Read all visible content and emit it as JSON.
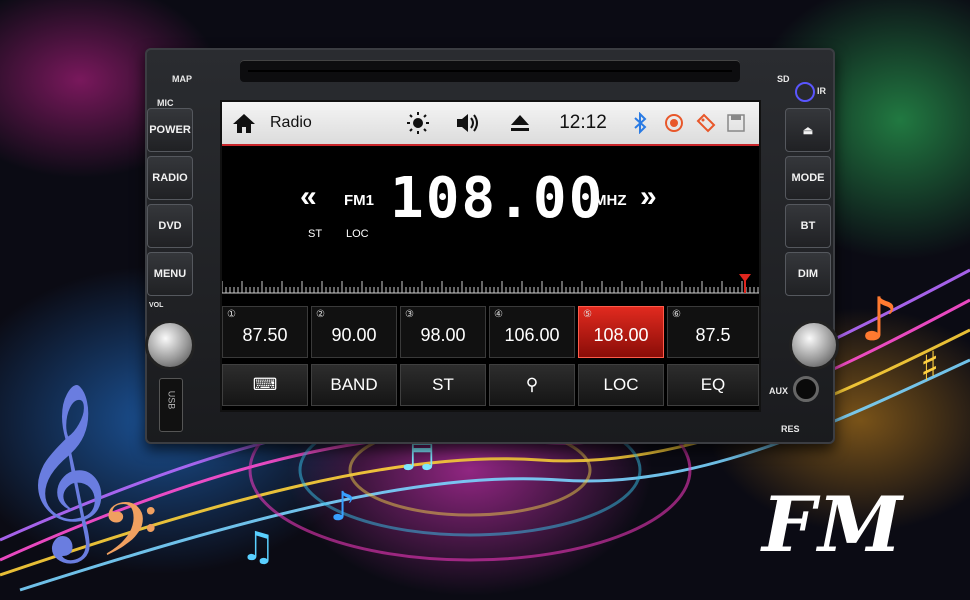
{
  "unit": {
    "labels": {
      "map": "MAP",
      "mic": "MIC",
      "sd": "SD",
      "ir": "IR",
      "vol": "VOL",
      "aux": "AUX",
      "res": "RES",
      "usb": "USB"
    },
    "left_buttons": [
      "POWER",
      "RADIO",
      "DVD",
      "MENU"
    ],
    "right_buttons": [
      "⏏",
      "MODE",
      "BT",
      "DIM"
    ]
  },
  "status_bar": {
    "title": "Radio",
    "time": "12:12",
    "icons": [
      "home-icon",
      "brightness-icon",
      "volume-icon",
      "eject-icon",
      "bluetooth-icon",
      "record-icon",
      "tag-icon",
      "save-icon"
    ]
  },
  "tuner": {
    "band": "FM1",
    "frequency": "108.00",
    "unit": "MHZ",
    "st": "ST",
    "loc": "LOC"
  },
  "presets": [
    {
      "num": "①",
      "value": "87.50",
      "active": false
    },
    {
      "num": "②",
      "value": "90.00",
      "active": false
    },
    {
      "num": "③",
      "value": "98.00",
      "active": false
    },
    {
      "num": "④",
      "value": "106.00",
      "active": false
    },
    {
      "num": "⑤",
      "value": "108.00",
      "active": true
    },
    {
      "num": "⑥",
      "value": "87.5",
      "active": false
    }
  ],
  "functions": [
    "⌨",
    "BAND",
    "ST",
    "⚲",
    "LOC",
    "EQ"
  ],
  "banner": "FM",
  "colors": {
    "accent": "#c9262b",
    "active_preset": "#e12a1f"
  }
}
